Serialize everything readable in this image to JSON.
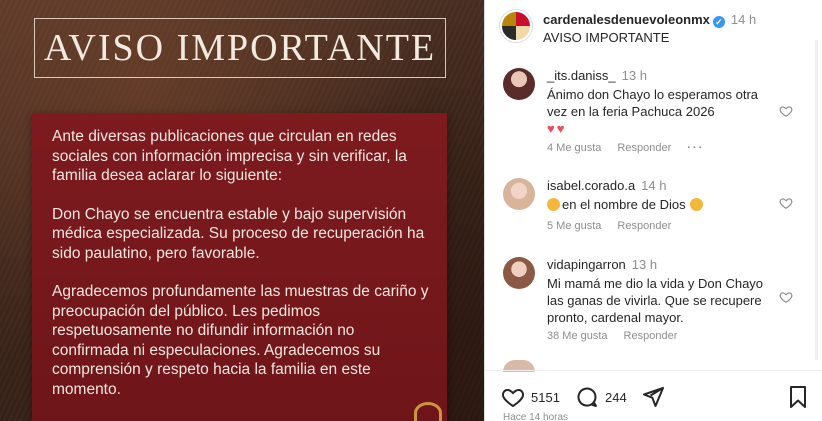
{
  "post": {
    "title": "AVISO IMPORTANTE",
    "paragraphs": [
      "Ante diversas publicaciones que circulan en redes sociales con información imprecisa y sin verificar, la familia desea aclarar lo siguiente:",
      "Don Chayo se encuentra estable y bajo supervisión médica especializada. Su proceso de recuperación ha sido paulatino, pero favorable.",
      "Agradecemos profundamente las muestras de cariño y preocupación del público. Les pedimos respetuosamente no difundir información no confirmada ni especulaciones. Agradecemos su comprensión y respeto hacia la familia en este momento."
    ]
  },
  "header": {
    "username": "cardenalesdenuevoleonmx",
    "verified_mark": "✓",
    "time": "14 h",
    "caption": "AVISO IMPORTANTE"
  },
  "comments": [
    {
      "username": "_its.daniss_",
      "time": "13 h",
      "text": "Ánimo don Chayo lo esperamos otra vez en la feria Pachuca 2026",
      "emoji": [
        "♥",
        "♥"
      ],
      "likes": "4 Me gusta",
      "reply": "Responder",
      "more": "···"
    },
    {
      "username": "isabel.corado.a",
      "time": "14 h",
      "text": "en el nombre de Dios",
      "likes": "5 Me gusta",
      "reply": "Responder"
    },
    {
      "username": "vidapingarron",
      "time": "13 h",
      "text": "Mi mamá me dio la vida y Don Chayo las ganas de vivirla. Que se recupere pronto, cardenal mayor.",
      "likes": "38 Me gusta",
      "reply": "Responder"
    }
  ],
  "actions": {
    "like_count": "5151",
    "comment_count": "244"
  },
  "time_ago": "Hace 14 horas",
  "colors": {
    "card_red": "#7d1b1f",
    "brown_bg": "#3f271c",
    "verified_blue": "#3897f0",
    "heart_red": "#ed4956"
  }
}
